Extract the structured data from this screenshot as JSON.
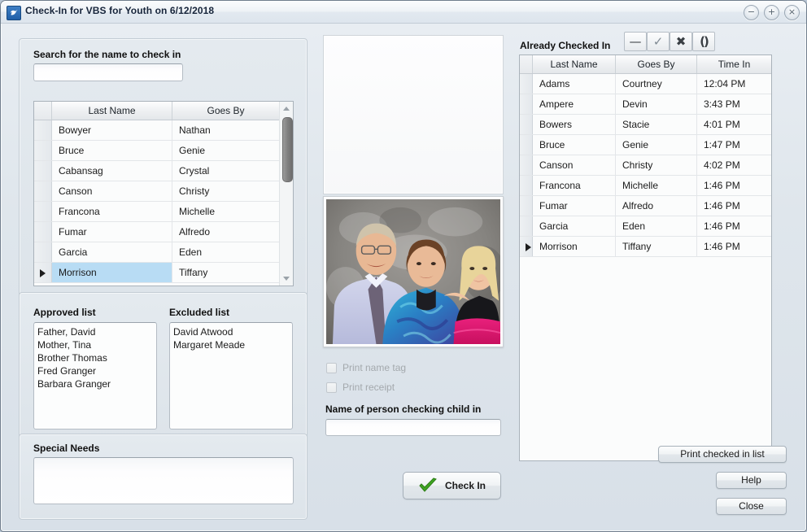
{
  "window": {
    "title": "Check-In for VBS for Youth on 6/12/2018",
    "icon": "dove-icon",
    "controls": {
      "minimize": "−",
      "maximize": "+",
      "close": "×"
    }
  },
  "search": {
    "label": "Search for the name to check in",
    "value": "",
    "placeholder": ""
  },
  "name_grid": {
    "columns": [
      "Last Name",
      "Goes By"
    ],
    "rows": [
      {
        "last_name": "Bowyer",
        "goes_by": "Nathan",
        "selected": false
      },
      {
        "last_name": "Bruce",
        "goes_by": "Genie",
        "selected": false
      },
      {
        "last_name": "Cabansag",
        "goes_by": "Crystal",
        "selected": false
      },
      {
        "last_name": "Canson",
        "goes_by": "Christy",
        "selected": false
      },
      {
        "last_name": "Francona",
        "goes_by": "Michelle",
        "selected": false
      },
      {
        "last_name": "Fumar",
        "goes_by": "Alfredo",
        "selected": false
      },
      {
        "last_name": "Garcia",
        "goes_by": "Eden",
        "selected": false
      },
      {
        "last_name": "Morrison",
        "goes_by": "Tiffany",
        "selected": true
      }
    ]
  },
  "approved": {
    "label": "Approved list",
    "items": [
      "Father, David",
      "Mother, Tina",
      "Brother Thomas",
      "Fred Granger",
      "Barbara Granger"
    ]
  },
  "excluded": {
    "label": "Excluded list",
    "items": [
      "David Atwood",
      "Margaret Meade"
    ]
  },
  "special_needs": {
    "label": "Special Needs",
    "value": ""
  },
  "center": {
    "print_name_tag": {
      "label": "Print name tag",
      "checked": false,
      "enabled": false
    },
    "print_receipt": {
      "label": "Print receipt",
      "checked": false,
      "enabled": false
    },
    "checker_label": "Name of person checking child in",
    "checker_value": "",
    "check_in_button": "Check In"
  },
  "already": {
    "title": "Already Checked In",
    "toolbar": [
      {
        "name": "remove-icon",
        "glyph": "—"
      },
      {
        "name": "check-icon",
        "glyph": "✓"
      },
      {
        "name": "delete-icon",
        "glyph": "✖"
      },
      {
        "name": "refresh-icon",
        "glyph": "()"
      }
    ],
    "columns": [
      "Last Name",
      "Goes By",
      "Time In"
    ],
    "rows": [
      {
        "last_name": "Adams",
        "goes_by": "Courtney",
        "time_in": "12:04 PM",
        "current": false
      },
      {
        "last_name": "Ampere",
        "goes_by": "Devin",
        "time_in": "3:43 PM",
        "current": false
      },
      {
        "last_name": "Bowers",
        "goes_by": "Stacie",
        "time_in": "4:01 PM",
        "current": false
      },
      {
        "last_name": "Bruce",
        "goes_by": "Genie",
        "time_in": "1:47 PM",
        "current": false
      },
      {
        "last_name": "Canson",
        "goes_by": "Christy",
        "time_in": "4:02 PM",
        "current": false
      },
      {
        "last_name": "Francona",
        "goes_by": "Michelle",
        "time_in": "1:46 PM",
        "current": false
      },
      {
        "last_name": "Fumar",
        "goes_by": "Alfredo",
        "time_in": "1:46 PM",
        "current": false
      },
      {
        "last_name": "Garcia",
        "goes_by": "Eden",
        "time_in": "1:46 PM",
        "current": false
      },
      {
        "last_name": "Morrison",
        "goes_by": "Tiffany",
        "time_in": "1:46 PM",
        "current": true
      }
    ]
  },
  "footer": {
    "print_list": "Print checked in list",
    "help": "Help",
    "close": "Close"
  },
  "colors": {
    "selection": "#b8dcf4",
    "accent_green": "#3fa521",
    "window_bg": "#dfe6ec"
  }
}
